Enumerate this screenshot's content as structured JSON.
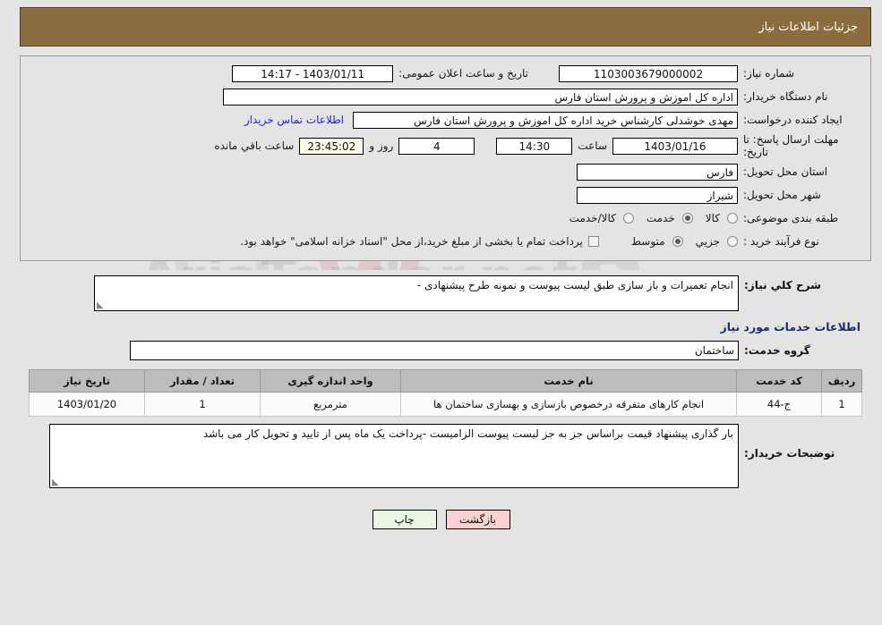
{
  "header": {
    "title": "جزئیات اطلاعات نیاز"
  },
  "top": {
    "need_number_label": "شماره نیاز:",
    "need_number_value": "1103003679000002",
    "announce_label": "تاریخ و ساعت اعلان عمومی:",
    "announce_value": "1403/01/11 - 14:17",
    "buyer_org_label": "نام دستگاه خریدار:",
    "buyer_org_value": "اداره کل اموزش و پرورش استان فارس",
    "creator_label": "ایجاد کننده درخواست:",
    "creator_value": "مهدی خوشدلی کارشناس خرید اداره کل اموزش و پرورش استان فارس",
    "contact_link": "اطلاعات تماس خریدار",
    "deadline_label": "مهلت ارسال پاسخ: تا تاریخ:",
    "deadline_date": "1403/01/16",
    "hour_label": "ساعت",
    "deadline_time": "14:30",
    "days_value": "4",
    "days_label": "روز و",
    "countdown_value": "23:45:02",
    "countdown_label": "ساعت باقي مانده",
    "province_label": "استان محل تحویل:",
    "province_value": "فارس",
    "city_label": "شهر محل تحویل:",
    "city_value": "شیراز",
    "category_label": "طبقه بندی موضوعی:",
    "category_options": [
      {
        "label": "کالا",
        "selected": false
      },
      {
        "label": "خدمت",
        "selected": true
      },
      {
        "label": "کالا/خدمت",
        "selected": false
      }
    ],
    "process_label": "نوع فرآیند خرید :",
    "process_options": [
      {
        "label": "جزیي",
        "selected": false
      },
      {
        "label": "متوسط",
        "selected": true
      }
    ],
    "treasury_checkbox_checked": false,
    "treasury_text": "پرداخت تمام یا بخشی از مبلغ خرید،از محل \"اسناد خزانه اسلامی\" خواهد بود."
  },
  "need": {
    "summary_label": "شرح کلي نیاز:",
    "summary_value": "انجام تعمیرات و باز سازی طبق لیست پیوست و نمونه طرح پیشنهادی -",
    "section_title": "اطلاعات خدمات مورد نیاز",
    "service_group_label": "گروه خدمت:",
    "service_group_value": "ساختمان"
  },
  "table": {
    "columns": [
      "ردیف",
      "کد خدمت",
      "نام خدمت",
      "واحد اندازه گیری",
      "تعداد / مقدار",
      "تاریخ نیاز"
    ],
    "rows": [
      {
        "index": "1",
        "service_code": "ج-44",
        "service_name": "انجام کارهای متفرقه درخصوص بازسازی و بهسازی ساختمان ها",
        "unit": "مترمربع",
        "quantity": "1",
        "need_date": "1403/01/20"
      }
    ]
  },
  "notes": {
    "label": "توضیحات خریدار:",
    "value": "بار گذاری پیشنهاد قیمت براساس جز به جز لیست پیوست الزامیست -پرداخت یک ماه پس از تایید و تحویل کار می باشد"
  },
  "footer": {
    "print_label": "چاپ",
    "back_label": "بازگشت"
  },
  "watermark": {
    "text_left": "Arı",
    "text_mid": "aTender",
    "text_right": ".net"
  }
}
